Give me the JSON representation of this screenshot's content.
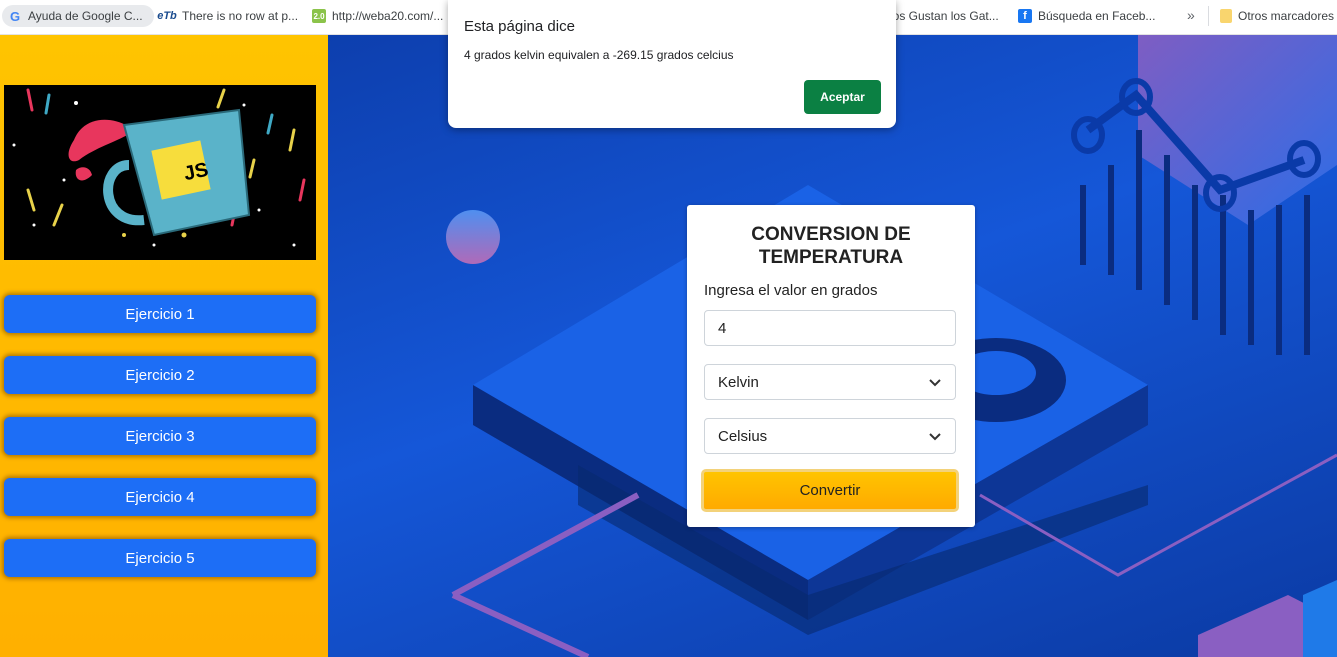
{
  "bookmarks": [
    {
      "label": "Ayuda de Google C...",
      "favicon": "google-g"
    },
    {
      "label": "There is no row at p...",
      "favicon": "etb"
    },
    {
      "label": "http://weba20.com/...",
      "favicon": "web20"
    },
    {
      "label": "los Gustan los Gat...",
      "favicon": "none"
    },
    {
      "label": "Búsqueda en Faceb...",
      "favicon": "facebook"
    },
    {
      "label": "Otros marcadores",
      "favicon": "folder"
    }
  ],
  "bookmarks_overflow": "»",
  "favicon_text": {
    "google": "G",
    "etb": "eTb",
    "web20": "2.0",
    "facebook": "f"
  },
  "logo": {
    "badge_text": "JS"
  },
  "sidebar": {
    "items": [
      {
        "label": "Ejercicio 1"
      },
      {
        "label": "Ejercicio 2"
      },
      {
        "label": "Ejercicio 3"
      },
      {
        "label": "Ejercicio 4"
      },
      {
        "label": "Ejercicio 5"
      }
    ]
  },
  "card": {
    "title_line1": "CONVERSION DE",
    "title_line2": "TEMPERATURA",
    "label": "Ingresa el valor en grados",
    "input_value": "4",
    "from_unit": "Kelvin",
    "to_unit": "Celsius",
    "button_label": "Convertir"
  },
  "dialog": {
    "title": "Esta página dice",
    "message": "4 grados kelvin equivalen a -269.15 grados celcius",
    "button_label": "Aceptar"
  },
  "colors": {
    "sidebar": "#ffc400",
    "menu_button": "#1d6ef6",
    "main_bg": "#1557d8",
    "convert_button": "#ffb300",
    "dialog_button": "#0b8043"
  }
}
